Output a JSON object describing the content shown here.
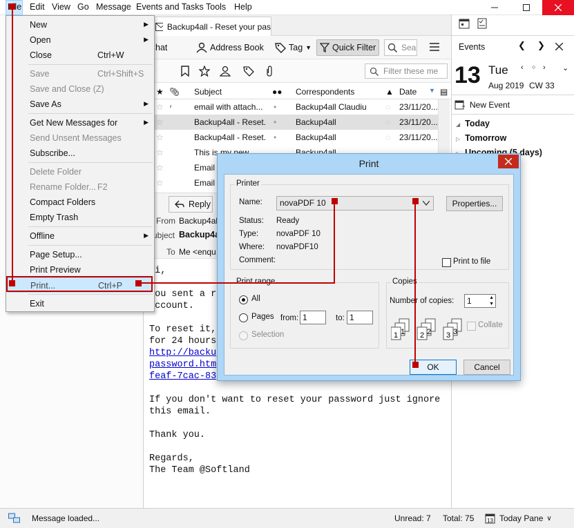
{
  "menubar": {
    "items": [
      "File",
      "Edit",
      "View",
      "Go",
      "Message",
      "Events and Tasks",
      "Tools",
      "Help"
    ]
  },
  "tab": {
    "label": "Backup4all - Reset your pas"
  },
  "toolbar": {
    "chat": "Chat",
    "address_book": "Address Book",
    "tag": "Tag",
    "quick_filter": "Quick Filter",
    "search_placeholder": "Sea"
  },
  "filterbar": {
    "placeholder": "Filter these me"
  },
  "thread_pane": {
    "columns": {
      "subject": "Subject",
      "correspondents": "Correspondents",
      "date": "Date"
    },
    "rows": [
      {
        "subject": "email with attach...",
        "correspondent": "Backup4all Claudiu",
        "date": "23/11/20..."
      },
      {
        "subject": "Backup4all - Reset...",
        "correspondent": "Backup4all",
        "date": "23/11/20..."
      },
      {
        "subject": "Backup4all - Reset...",
        "correspondent": "Backup4all",
        "date": "23/11/20..."
      },
      {
        "subject": "This is my new...",
        "correspondent": "Backup4all",
        "date": "23/11/20..."
      },
      {
        "subject": "Email",
        "correspondent": "",
        "date": ""
      },
      {
        "subject": "Email",
        "correspondent": "",
        "date": ""
      }
    ]
  },
  "message": {
    "reply": "Reply",
    "from_label": "From",
    "from_value": "Backup4all",
    "subject_label": "Subject",
    "subject_value": "Backup4a",
    "to_label": "To",
    "to_value": "Me <enqu",
    "body_lines": [
      "Hi,",
      "",
      "You sent a r",
      "account.",
      "",
      "To reset it,",
      "for 24 hours",
      "http://backu",
      "password.htm",
      "feaf-7cac-83",
      "",
      "If you don't want to reset your password just ignore",
      "this email.",
      "",
      "Thank you.",
      "",
      "Regards,",
      "The Team @Softland"
    ]
  },
  "today_pane": {
    "title": "Events",
    "day_number": "13",
    "weekday": "Tue",
    "month_year": "Aug 2019",
    "week": "CW 33",
    "new_event": "New Event",
    "sections": [
      "Today",
      "Tomorrow",
      "Upcoming (5 days)"
    ]
  },
  "file_menu": {
    "items": [
      {
        "label": "New",
        "shortcut": "",
        "submenu": true,
        "disabled": false
      },
      {
        "label": "Open",
        "shortcut": "",
        "submenu": true,
        "disabled": false
      },
      {
        "label": "Close",
        "shortcut": "Ctrl+W",
        "submenu": false,
        "disabled": false
      },
      {
        "label": "Save",
        "shortcut": "Ctrl+Shift+S",
        "submenu": false,
        "disabled": true
      },
      {
        "label": "Save and Close (Z)",
        "shortcut": "",
        "submenu": false,
        "disabled": true
      },
      {
        "label": "Save As",
        "shortcut": "",
        "submenu": true,
        "disabled": false
      },
      {
        "label": "Get New Messages for",
        "shortcut": "",
        "submenu": true,
        "disabled": false
      },
      {
        "label": "Send Unsent Messages",
        "shortcut": "",
        "submenu": false,
        "disabled": true
      },
      {
        "label": "Subscribe...",
        "shortcut": "",
        "submenu": false,
        "disabled": false
      },
      {
        "label": "Delete Folder",
        "shortcut": "",
        "submenu": false,
        "disabled": true
      },
      {
        "label": "Rename Folder...",
        "shortcut": "F2",
        "submenu": false,
        "disabled": true
      },
      {
        "label": "Compact Folders",
        "shortcut": "",
        "submenu": false,
        "disabled": false
      },
      {
        "label": "Empty Trash",
        "shortcut": "",
        "submenu": false,
        "disabled": false
      },
      {
        "label": "Offline",
        "shortcut": "",
        "submenu": true,
        "disabled": false
      },
      {
        "label": "Page Setup...",
        "shortcut": "",
        "submenu": false,
        "disabled": false
      },
      {
        "label": "Print Preview",
        "shortcut": "",
        "submenu": false,
        "disabled": false
      },
      {
        "label": "Print...",
        "shortcut": "Ctrl+P",
        "submenu": false,
        "disabled": false
      },
      {
        "label": "Exit",
        "shortcut": "",
        "submenu": false,
        "disabled": false
      }
    ]
  },
  "print_dialog": {
    "title": "Print",
    "printer_group": "Printer",
    "name_label": "Name:",
    "name_value": "novaPDF 10",
    "properties": "Properties...",
    "status_label": "Status:",
    "status_value": "Ready",
    "type_label": "Type:",
    "type_value": "novaPDF 10",
    "where_label": "Where:",
    "where_value": "novaPDF10",
    "comment_label": "Comment:",
    "print_to_file": "Print to file",
    "range_group": "Print range",
    "all": "All",
    "pages": "Pages",
    "from_label": "from:",
    "from_value": "1",
    "to_label": "to:",
    "to_value": "1",
    "selection": "Selection",
    "copies_group": "Copies",
    "num_copies_label": "Number of copies:",
    "num_copies_value": "1",
    "collate": "Collate",
    "ok": "OK",
    "cancel": "Cancel"
  },
  "statusbar": {
    "message": "Message loaded...",
    "unread": "Unread: 7",
    "total": "Total: 75",
    "today_pane": "Today Pane"
  },
  "colors": {
    "annotation": "#c00000",
    "menu_highlight": "#cce8ff",
    "dialog_frame": "#aed6f7",
    "close_red": "#e81123"
  }
}
